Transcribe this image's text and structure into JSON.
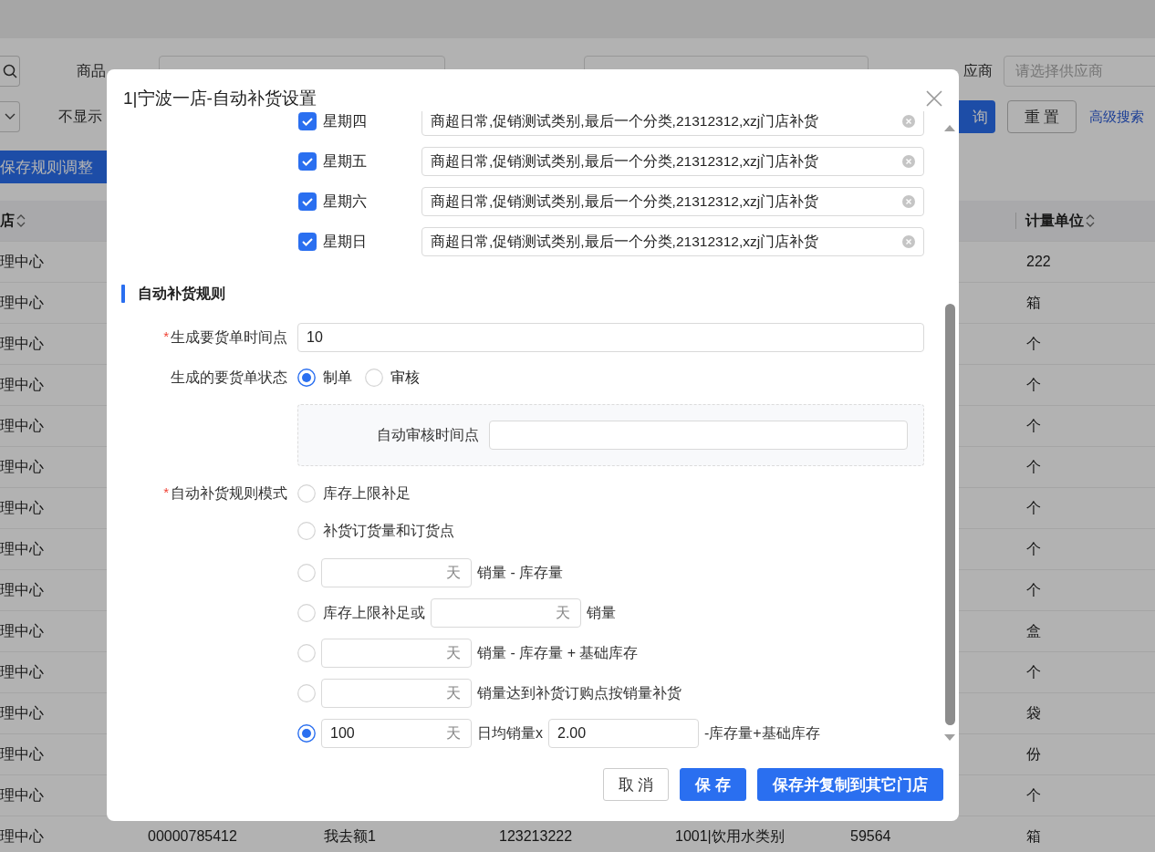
{
  "background": {
    "search_row": [
      {
        "label": "商品"
      },
      {
        "label": "应商",
        "placeholder": "请选择供应商"
      }
    ],
    "second_row": {
      "label": "不显示",
      "query_button": "询",
      "reset_button": "重 置",
      "advanced_link": "高级搜索"
    },
    "save_rules_button": "保存规则调整",
    "table": {
      "columns": [
        {
          "label": "店"
        },
        {
          "label": "计量单位"
        }
      ],
      "rows": [
        {
          "store": "理中心",
          "unit": "222"
        },
        {
          "store": "理中心",
          "unit": "箱"
        },
        {
          "store": "理中心",
          "unit": "个"
        },
        {
          "store": "理中心",
          "unit": "个"
        },
        {
          "store": "理中心",
          "unit": "个"
        },
        {
          "store": "理中心",
          "unit": "个"
        },
        {
          "store": "理中心",
          "unit": "个"
        },
        {
          "store": "理中心",
          "unit": "个"
        },
        {
          "store": "理中心",
          "unit": "个"
        },
        {
          "store": "理中心",
          "unit": "盒"
        },
        {
          "store": "理中心",
          "unit": "个"
        },
        {
          "store": "理中心",
          "unit": "袋"
        },
        {
          "store": "理中心",
          "unit": "份"
        },
        {
          "store": "理中心",
          "unit": "个"
        },
        {
          "store": "理中心",
          "unit": "箱",
          "middle": [
            "00000785412",
            "我去额1",
            "123213222",
            "1001|饮用水类别",
            "59564"
          ]
        }
      ]
    }
  },
  "dialog": {
    "title": "1|宁波一店-自动补货设置",
    "weekdays": [
      {
        "label": "星期四",
        "checked": true,
        "value": "商超日常,促销测试类别,最后一个分类,21312312,xzj门店补货"
      },
      {
        "label": "星期五",
        "checked": true,
        "value": "商超日常,促销测试类别,最后一个分类,21312312,xzj门店补货"
      },
      {
        "label": "星期六",
        "checked": true,
        "value": "商超日常,促销测试类别,最后一个分类,21312312,xzj门店补货"
      },
      {
        "label": "星期日",
        "checked": true,
        "value": "商超日常,促销测试类别,最后一个分类,21312312,xzj门店补货"
      }
    ],
    "section_title": "自动补货规则",
    "order_time": {
      "required_mark": "*",
      "label": "生成要货单时间点",
      "value": "10"
    },
    "order_status": {
      "label": "生成的要货单状态",
      "options": [
        {
          "label": "制单",
          "selected": true
        },
        {
          "label": "审核",
          "selected": false
        }
      ]
    },
    "auto_review": {
      "label": "自动审核时间点"
    },
    "rule_mode": {
      "required_mark": "*",
      "label": "自动补货规则模式",
      "options": [
        {
          "selected": false,
          "parts": [
            {
              "kind": "text",
              "text": "库存上限补足"
            }
          ]
        },
        {
          "selected": false,
          "parts": [
            {
              "kind": "text",
              "text": "补货订货量和订货点"
            }
          ]
        },
        {
          "selected": false,
          "parts": [
            {
              "kind": "days",
              "unit": "天"
            },
            {
              "kind": "text",
              "text": "销量 - 库存量"
            }
          ]
        },
        {
          "selected": false,
          "parts": [
            {
              "kind": "text",
              "text": "库存上限补足或"
            },
            {
              "kind": "days",
              "unit": "天"
            },
            {
              "kind": "text",
              "text": "销量"
            }
          ]
        },
        {
          "selected": false,
          "parts": [
            {
              "kind": "days",
              "unit": "天"
            },
            {
              "kind": "text",
              "text": "销量 - 库存量 + 基础库存"
            }
          ]
        },
        {
          "selected": false,
          "parts": [
            {
              "kind": "days",
              "unit": "天"
            },
            {
              "kind": "text",
              "text": "销量达到补货订购点按销量补货"
            }
          ]
        },
        {
          "selected": true,
          "parts": [
            {
              "kind": "days",
              "unit": "天",
              "value": "100"
            },
            {
              "kind": "text",
              "text": "日均销量x"
            },
            {
              "kind": "input",
              "value": "2.00"
            },
            {
              "kind": "text",
              "text": "-库存量+基础库存"
            }
          ]
        }
      ]
    },
    "buttons": [
      {
        "label": "取 消",
        "kind": "default"
      },
      {
        "label": "保 存",
        "kind": "primary"
      },
      {
        "label": "保存并复制到其它门店",
        "kind": "primary"
      }
    ]
  }
}
